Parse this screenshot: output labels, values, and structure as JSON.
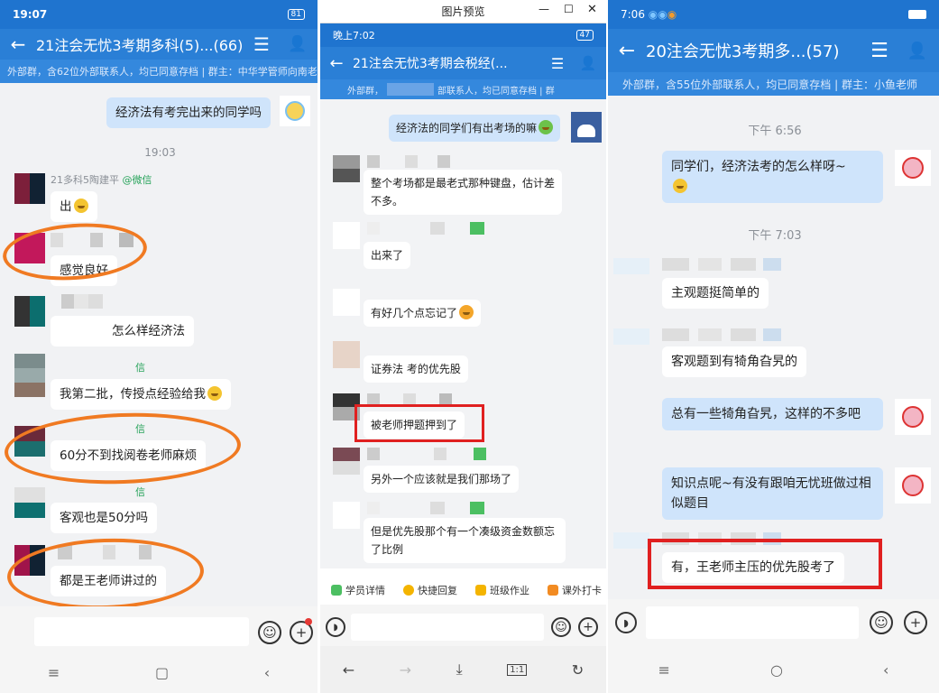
{
  "panel1": {
    "status_time": "19:07",
    "status_battery": "81",
    "title": "21注会无忧3考期多科(5)...(66)",
    "subtitle": "外部群，含62位外部联系人，均已同意存档 | 群主：中华学管师向南老师",
    "my_msg": "经济法有考完出来的同学吗",
    "time_label": "19:03",
    "sender_name": "21多科5陶建平",
    "sender_tag": "@微信",
    "msgs": [
      "出",
      "感觉良好",
      "怎么样经济法",
      "我第二批，传授点经验给我",
      "60分不到找阅卷老师麻烦",
      "客观也是50分吗",
      "都是王老师讲过的"
    ],
    "tag_wechat": "信"
  },
  "panel2": {
    "window_title": "图片预览",
    "status_time": "晚上7:02",
    "status_battery": "47",
    "title": "21注会无忧3考期会税经(...",
    "subtitle_left": "外部群，",
    "subtitle_right": "部联系人，均已同意存档 | 群",
    "my_msg": "经济法的同学们有出考场的嘛",
    "msgs": [
      "整个考场都是最老式那种键盘，估计差不多。",
      "出来了",
      "有好几个点忘记了",
      "证券法 考的优先股",
      "被老师押题押到了",
      "另外一个应该就是我们那场了",
      "但是优先股那个有一个凑级资金数额忘了比例"
    ],
    "tools": [
      "学员详情",
      "快捷回复",
      "班级作业",
      "课外打卡"
    ],
    "zoom_label": "1:1"
  },
  "panel3": {
    "status_time": "7:06",
    "title": "20注会无忧3考期多...(57)",
    "subtitle": "外部群，含55位外部联系人，均已同意存档 | 群主：小鱼老师",
    "time1": "下午 6:56",
    "my_msg1": "同学们，经济法考的怎么样呀~",
    "time2": "下午 7:03",
    "msgs": [
      "主观题挺简单的",
      "客观题到有犄角旮旯的"
    ],
    "my_msg2": "总有一些犄角旮旯，这样的不多吧",
    "my_msg3": "知识点呢~有没有跟咱无忧班做过相似题目",
    "reply": "有，王老师主压的优先股考了"
  }
}
